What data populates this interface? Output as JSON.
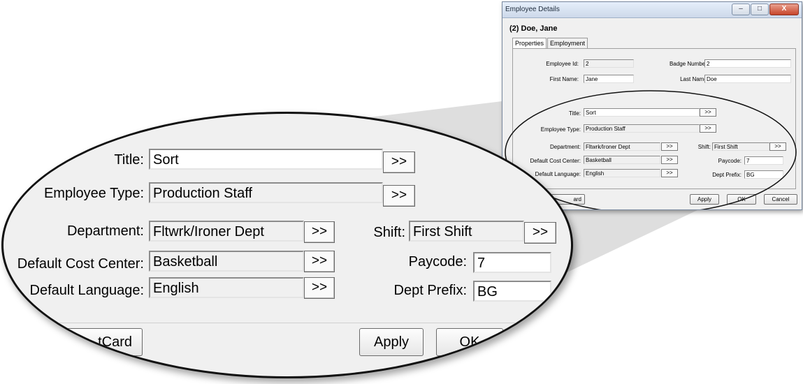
{
  "window": {
    "title": "Employee Details",
    "header": "(2) Doe, Jane",
    "controls": {
      "minimize": "–",
      "maximize": "□",
      "close": "X"
    },
    "tabs": [
      {
        "label": "Properties",
        "active": true
      },
      {
        "label": "Employment",
        "active": false
      }
    ]
  },
  "form": {
    "employee_id": {
      "label": "Employee Id:",
      "value": "2"
    },
    "badge_number": {
      "label": "Badge Number:",
      "value": "2"
    },
    "first_name": {
      "label": "First Name:",
      "value": "Jane"
    },
    "last_name": {
      "label": "Last Name:",
      "value": "Doe"
    },
    "title": {
      "label": "Title:",
      "value": "Sort"
    },
    "employee_type": {
      "label": "Employee Type:",
      "value": "Production Staff"
    },
    "department": {
      "label": "Department:",
      "value": "Fltwrk/Ironer Dept"
    },
    "default_cost_center": {
      "label": "Default Cost Center:",
      "value": "Basketball"
    },
    "default_language": {
      "label": "Default Language:",
      "value": "English"
    },
    "shift": {
      "label": "Shift:",
      "value": "First Shift"
    },
    "paycode": {
      "label": "Paycode:",
      "value": "7"
    },
    "dept_prefix": {
      "label": "Dept Prefix:",
      "value": "BG"
    },
    "browse_label": ">>"
  },
  "buttons": {
    "card_small": "ard",
    "card_zoom": "tCard",
    "apply": "Apply",
    "ok": "OK",
    "cancel": "Cancel"
  }
}
